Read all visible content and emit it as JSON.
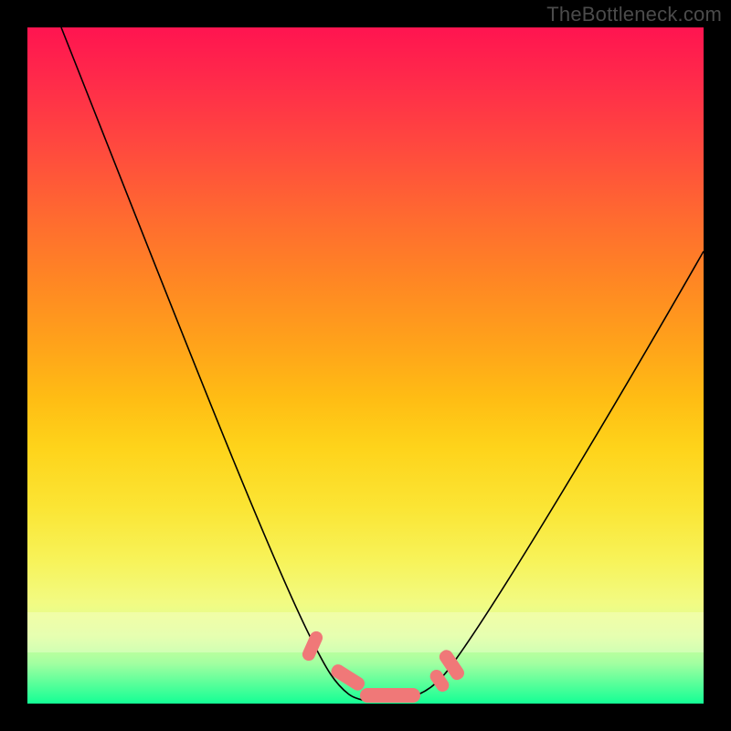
{
  "watermark": "TheBottleneck.com",
  "colors": {
    "marker": "#f07878",
    "curve": "#000000",
    "gradient_top": "#ff1450",
    "gradient_bottom": "#14ff95"
  },
  "chart_data": {
    "type": "line",
    "title": "",
    "xlabel": "",
    "ylabel": "",
    "xlim": [
      0,
      100
    ],
    "ylim": [
      0,
      100
    ],
    "grid": false,
    "legend": "none",
    "annotations": [
      "TheBottleneck.com"
    ],
    "series": [
      {
        "name": "bottleneck-curve",
        "x": [
          5,
          10,
          15,
          20,
          25,
          30,
          35,
          40,
          43,
          47,
          50,
          53,
          57,
          60,
          65,
          70,
          75,
          80,
          85,
          90,
          95,
          100
        ],
        "values": [
          100,
          90,
          79,
          68,
          56,
          44,
          32,
          20,
          11,
          4,
          1,
          0,
          0,
          1,
          4,
          10,
          18,
          27,
          36,
          46,
          56,
          67
        ]
      }
    ],
    "markers": [
      {
        "name": "trough-blob-left",
        "x": 43,
        "y": 8
      },
      {
        "name": "trough-blob-center-left",
        "x": 48,
        "y": 1
      },
      {
        "name": "trough-blob-center-right",
        "x": 55.5,
        "y": 0
      },
      {
        "name": "trough-blob-right-tick",
        "x": 62,
        "y": 3
      },
      {
        "name": "trough-blob-right",
        "x": 64,
        "y": 6
      }
    ]
  }
}
